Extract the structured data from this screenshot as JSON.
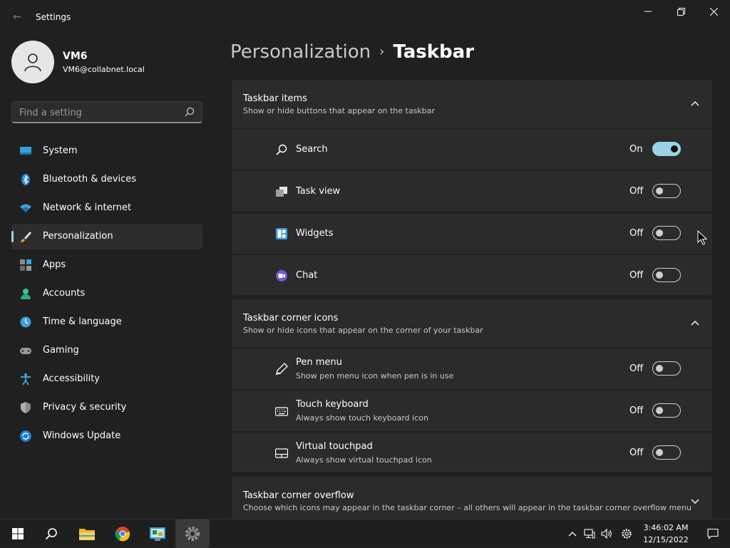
{
  "window": {
    "title": "Settings",
    "back": "←"
  },
  "user": {
    "name": "VM6",
    "email": "VM6@collabnet.local"
  },
  "search": {
    "placeholder": "Find a setting"
  },
  "nav": {
    "items": [
      {
        "label": "System",
        "icon": "system-icon"
      },
      {
        "label": "Bluetooth & devices",
        "icon": "bluetooth-icon"
      },
      {
        "label": "Network & internet",
        "icon": "wifi-icon"
      },
      {
        "label": "Personalization",
        "icon": "brush-icon",
        "active": true
      },
      {
        "label": "Apps",
        "icon": "apps-icon"
      },
      {
        "label": "Accounts",
        "icon": "accounts-icon"
      },
      {
        "label": "Time & language",
        "icon": "clock-icon"
      },
      {
        "label": "Gaming",
        "icon": "gamepad-icon"
      },
      {
        "label": "Accessibility",
        "icon": "accessibility-icon"
      },
      {
        "label": "Privacy & security",
        "icon": "shield-icon"
      },
      {
        "label": "Windows Update",
        "icon": "update-icon"
      }
    ]
  },
  "breadcrumb": {
    "parent": "Personalization",
    "separator": "›",
    "current": "Taskbar"
  },
  "groups": {
    "taskbar_items": {
      "title": "Taskbar items",
      "subtitle": "Show or hide buttons that appear on the taskbar",
      "rows": [
        {
          "title": "Search",
          "state": "On",
          "on": true,
          "icon": "search-icon"
        },
        {
          "title": "Task view",
          "state": "Off",
          "on": false,
          "icon": "task-view-icon"
        },
        {
          "title": "Widgets",
          "state": "Off",
          "on": false,
          "icon": "widgets-icon"
        },
        {
          "title": "Chat",
          "state": "Off",
          "on": false,
          "icon": "chat-icon"
        }
      ]
    },
    "corner_icons": {
      "title": "Taskbar corner icons",
      "subtitle": "Show or hide icons that appear on the corner of your taskbar",
      "rows": [
        {
          "title": "Pen menu",
          "subtitle": "Show pen menu icon when pen is in use",
          "state": "Off",
          "on": false,
          "icon": "pen-icon"
        },
        {
          "title": "Touch keyboard",
          "subtitle": "Always show touch keyboard icon",
          "state": "Off",
          "on": false,
          "icon": "keyboard-icon"
        },
        {
          "title": "Virtual touchpad",
          "subtitle": "Always show virtual touchpad icon",
          "state": "Off",
          "on": false,
          "icon": "touchpad-icon"
        }
      ]
    },
    "corner_overflow": {
      "title": "Taskbar corner overflow",
      "subtitle": "Choose which icons may appear in the taskbar corner – all others will appear in the taskbar corner overflow menu"
    }
  },
  "taskbar": {
    "apps": [
      "start-icon",
      "search-icon",
      "file-explorer-icon",
      "chrome-icon",
      "control-panel-icon",
      "settings-icon"
    ],
    "time": "3:46:02 AM",
    "date": "12/15/2022"
  },
  "colors": {
    "accent": "#9ad3e6",
    "background": "#202020",
    "card": "#2b2b2b"
  }
}
